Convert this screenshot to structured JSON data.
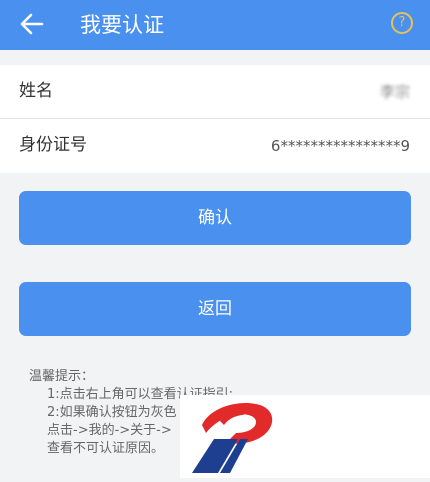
{
  "header": {
    "title": "我要认证",
    "help_glyph": "?"
  },
  "form": {
    "name_label": "姓名",
    "name_value": "李宗",
    "id_label": "身份证号",
    "id_value": "6****************9"
  },
  "buttons": {
    "confirm": "确认",
    "back": "返回"
  },
  "tips": {
    "title": "温馨提示：",
    "lines": [
      "1:点击右上角可以查看认证指引;",
      "2:如果确认按钮为灰色",
      "点击->我的->关于->",
      "查看不可认证原因。"
    ]
  },
  "colors": {
    "primary": "#4a90ee",
    "help_ring": "#e6c158",
    "logo_red": "#e32a2a",
    "logo_blue": "#1e3f8f"
  },
  "icons": {
    "back": "arrow-left-icon",
    "help": "question-circle-icon"
  }
}
